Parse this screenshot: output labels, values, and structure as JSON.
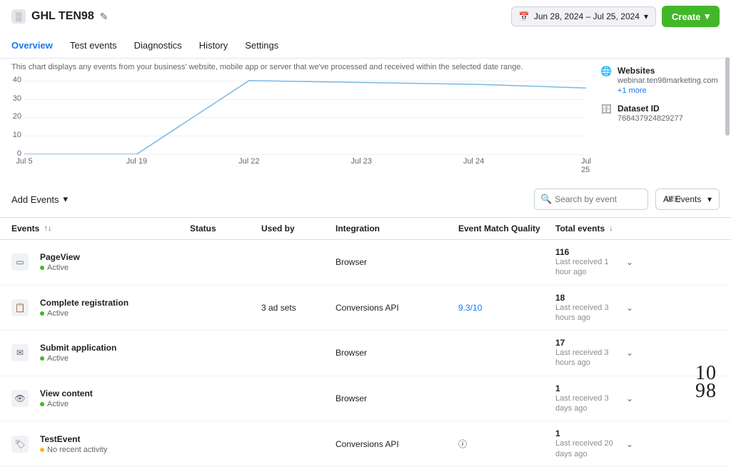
{
  "header": {
    "title": "GHL TEN98",
    "date_range": "Jun 28, 2024 – Jul 25, 2024",
    "create_label": "Create"
  },
  "tabs": [
    {
      "id": "overview",
      "label": "Overview",
      "active": true
    },
    {
      "id": "test",
      "label": "Test events",
      "active": false
    },
    {
      "id": "diagnostics",
      "label": "Diagnostics",
      "active": false
    },
    {
      "id": "history",
      "label": "History",
      "active": false
    },
    {
      "id": "settings",
      "label": "Settings",
      "active": false
    }
  ],
  "blurb": "This chart displays any events from your business' website, mobile app or server that we've processed and received within the selected date range.",
  "chart_data": {
    "type": "line",
    "x_labels": [
      "Jul 5",
      "Jul 19",
      "Jul 22",
      "Jul 23",
      "Jul 24",
      "Jul 25"
    ],
    "series": [
      {
        "name": "events",
        "values": [
          0,
          0,
          40,
          39,
          38,
          36
        ]
      }
    ],
    "y_ticks": [
      0,
      10,
      20,
      30,
      40
    ],
    "ylim": [
      0,
      45
    ],
    "xlabel": "",
    "ylabel": "",
    "title": ""
  },
  "side": {
    "websites_label": "Websites",
    "websites_value": "webinar.ten98marketing.com",
    "websites_more": "+1 more",
    "dataset_label": "Dataset ID",
    "dataset_value": "768437924829277"
  },
  "controls": {
    "add_events": "Add Events",
    "search_placeholder": "Search by event",
    "search_count": "0/50",
    "filter_label": "All Events"
  },
  "table": {
    "headers": {
      "events": "Events",
      "status": "Status",
      "used_by": "Used by",
      "integration": "Integration",
      "emq": "Event Match Quality",
      "totals": "Total events"
    },
    "rows": [
      {
        "icon": "window",
        "name": "PageView",
        "status": "Active",
        "status_type": "green",
        "used_by": "",
        "integration": "Browser",
        "emq": "",
        "info": false,
        "total": "116",
        "last": "Last received 1 hour ago"
      },
      {
        "icon": "clipboard",
        "name": "Complete registration",
        "status": "Active",
        "status_type": "green",
        "used_by": "3 ad sets",
        "integration": "Conversions API",
        "emq": "9.3/10",
        "info": false,
        "total": "18",
        "last": "Last received 3 hours ago"
      },
      {
        "icon": "mail",
        "name": "Submit application",
        "status": "Active",
        "status_type": "green",
        "used_by": "",
        "integration": "Browser",
        "emq": "",
        "info": false,
        "total": "17",
        "last": "Last received 3 hours ago"
      },
      {
        "icon": "eye",
        "name": "View content",
        "status": "Active",
        "status_type": "green",
        "used_by": "",
        "integration": "Browser",
        "emq": "",
        "info": false,
        "total": "1",
        "last": "Last received 3 days ago"
      },
      {
        "icon": "tag",
        "name": "TestEvent",
        "status": "No recent activity",
        "status_type": "orange",
        "used_by": "",
        "integration": "Conversions API",
        "emq": "",
        "info": true,
        "total": "1",
        "last": "Last received 20 days ago"
      }
    ]
  },
  "brand": "1098"
}
